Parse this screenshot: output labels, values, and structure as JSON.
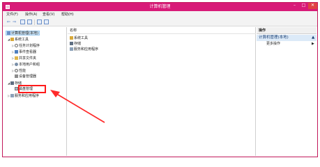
{
  "window": {
    "title": "计算机管理",
    "controls": {
      "minimize": "–",
      "maximize": "□",
      "close": "✕"
    }
  },
  "menu": {
    "items": [
      "文件(F)",
      "操作(A)",
      "查看(V)",
      "帮助(H)"
    ]
  },
  "toolbar": {
    "back": "⇦",
    "forward": "⇨"
  },
  "tree": {
    "root": "计算机管理(本地)",
    "system_tools": "系统工具",
    "task_scheduler": "任务计划程序",
    "event_viewer": "事件查看器",
    "shared_folders": "共享文件夹",
    "local_users": "本地用户和组",
    "performance": "性能",
    "device_manager": "设备管理器",
    "storage": "存储",
    "disk_management": "磁盘管理",
    "services_apps": "服务和应用程序"
  },
  "center": {
    "column_header": "名称",
    "rows": [
      "系统工具",
      "存储",
      "服务和应用程序"
    ]
  },
  "actions": {
    "header": "操作",
    "section_title": "计算机管理(本地)",
    "more_actions": "更多操作"
  },
  "colors": {
    "titlebar": "#d81b78",
    "highlight_box": "#ff1a1a",
    "arrow": "#ff2a2a"
  }
}
